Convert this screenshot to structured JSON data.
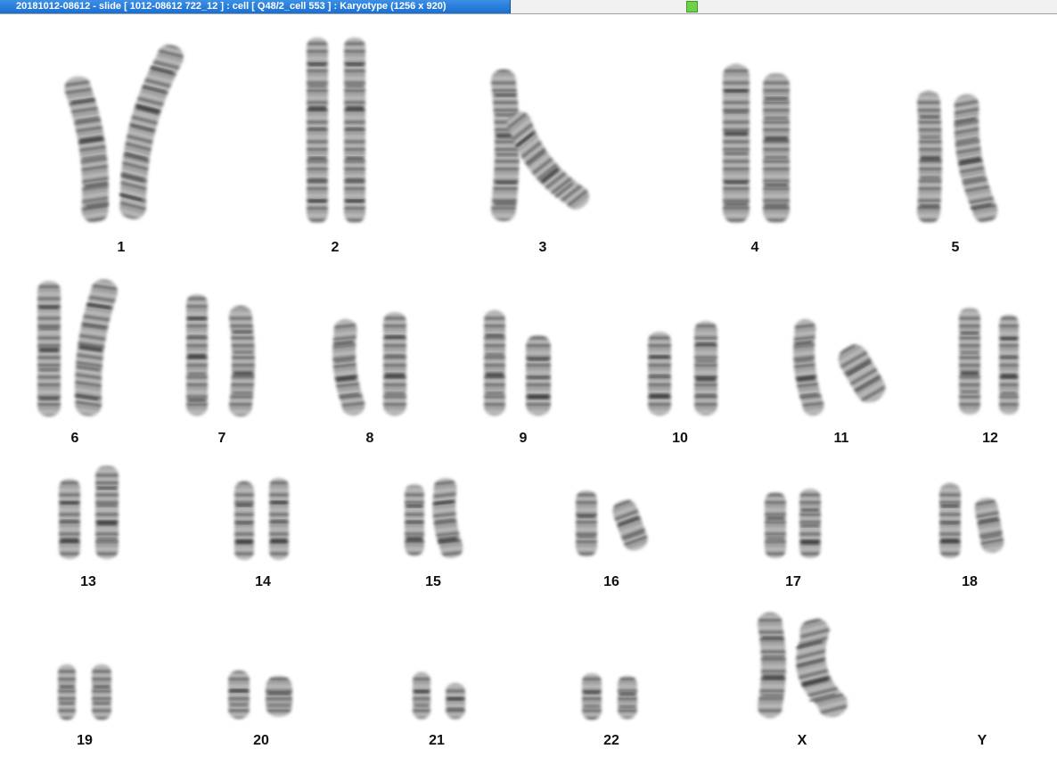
{
  "window": {
    "title": "20181012-08612 - slide [ 1012-08612 722_12 ] : cell [ Q48/2_cell 553 ] : Karyotype  (1256 x 920)",
    "status_color": "#6fd04a"
  },
  "karyotype": {
    "groups": [
      {
        "label": "1"
      },
      {
        "label": "2"
      },
      {
        "label": "3"
      },
      {
        "label": "4"
      },
      {
        "label": "5"
      },
      {
        "label": "6"
      },
      {
        "label": "7"
      },
      {
        "label": "8"
      },
      {
        "label": "9"
      },
      {
        "label": "10"
      },
      {
        "label": "11"
      },
      {
        "label": "12"
      },
      {
        "label": "13"
      },
      {
        "label": "14"
      },
      {
        "label": "15"
      },
      {
        "label": "16"
      },
      {
        "label": "17"
      },
      {
        "label": "18"
      },
      {
        "label": "19"
      },
      {
        "label": "20"
      },
      {
        "label": "21"
      },
      {
        "label": "22"
      },
      {
        "label": "X"
      },
      {
        "label": "Y"
      }
    ]
  }
}
